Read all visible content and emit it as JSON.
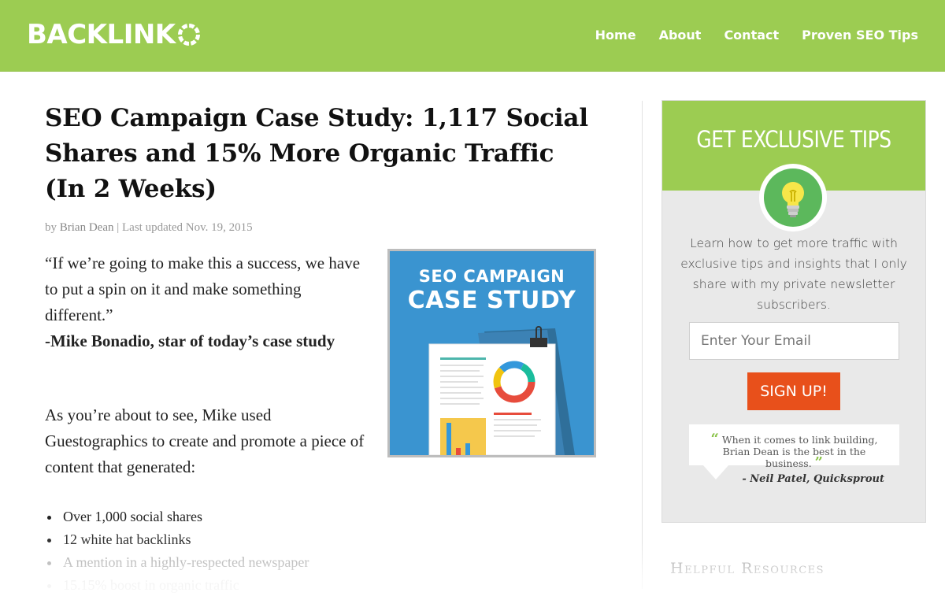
{
  "header": {
    "logo_text": "BACKLINK",
    "logo_suffix_icon": "target-o-icon",
    "nav": [
      {
        "label": "Home"
      },
      {
        "label": "About"
      },
      {
        "label": "Contact"
      },
      {
        "label": "Proven SEO Tips"
      }
    ],
    "bg_color": "#9ccc52"
  },
  "article": {
    "title": "SEO Campaign Case Study: 1,117 Social Shares and 15% More Organic Traffic (In 2 Weeks)",
    "byline_prefix": "by",
    "author": "Brian Dean",
    "byline_sep": "|",
    "updated": "Last updated Nov. 19, 2015",
    "quote": "“If we’re going to make this a success, we have to put a spin on it and make something different.”",
    "quote_attribution": "-Mike Bonadio, star of today’s case study",
    "paragraph": "As you’re about to see, Mike used Guestographics to create and promote a piece of content that generated:",
    "bullets": [
      "Over 1,000 social shares",
      "12 white hat backlinks",
      "A mention in a highly-respected newspaper",
      "15.15% boost in organic traffic"
    ],
    "image": {
      "line1": "SEO CAMPAIGN",
      "line2": "CASE STUDY",
      "bg_color": "#3a94d0"
    }
  },
  "sidebar": {
    "widget_title": "GET EXCLUSIVE TIPS",
    "widget_icon": "lightbulb-icon",
    "description": "Learn how to get more traffic ⁣with exclusive tips and insights ⁣that I only share with my private newsletter subscribers.",
    "email_placeholder": "Enter Your Email",
    "signup_label": "SIGN UP!",
    "testimonial_text": "When it comes to link building, Brian Dean is the best in the business.",
    "testimonial_author": "- Neil Patel, Quicksprout",
    "resources_title": "Helpful Resources",
    "accent_color": "#9ccc52",
    "button_color": "#e8501b"
  }
}
